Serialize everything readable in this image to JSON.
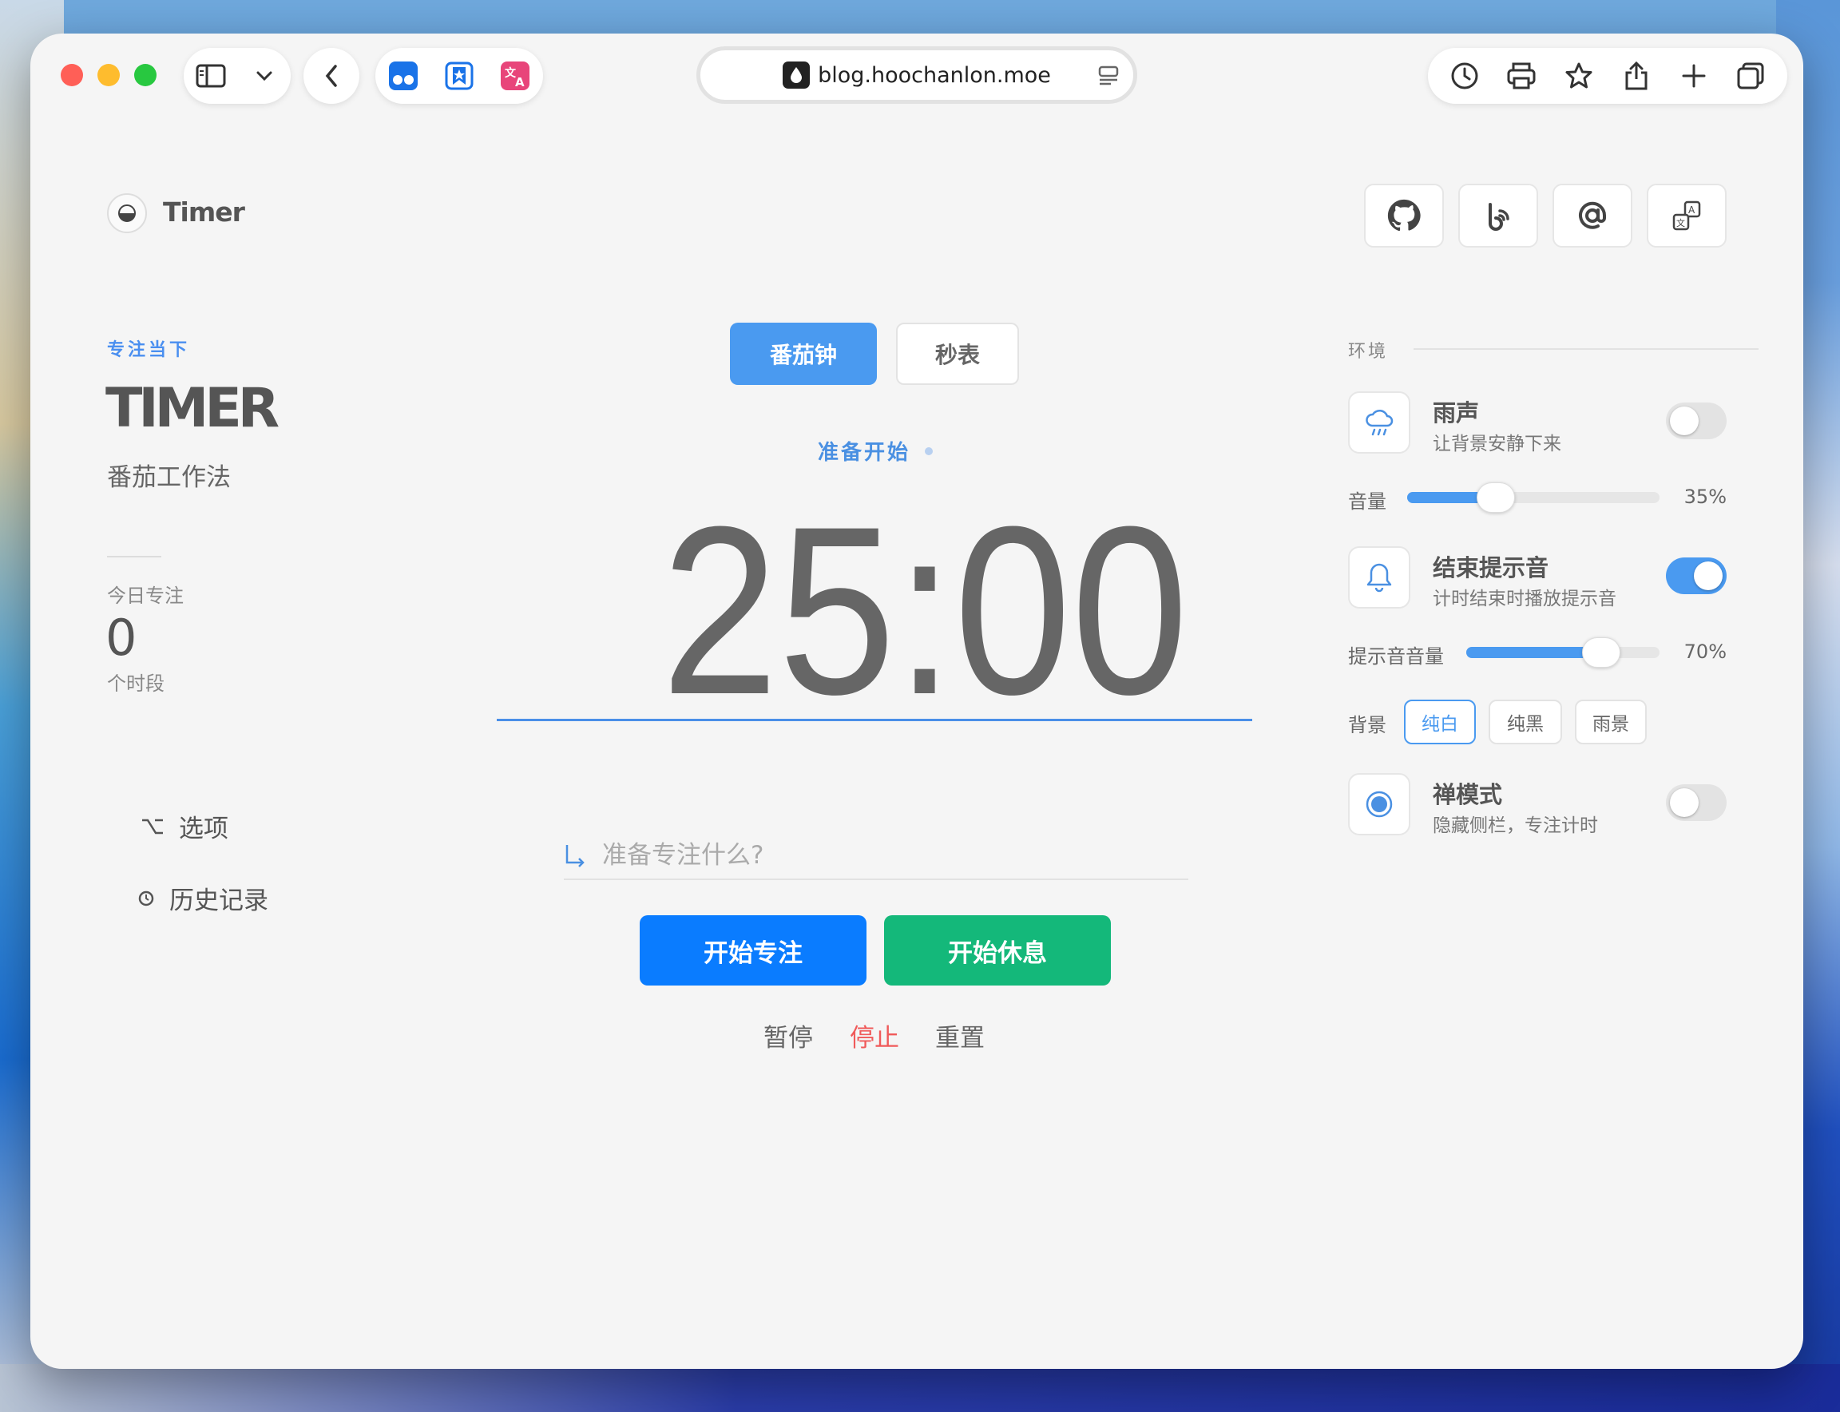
{
  "browser": {
    "url": "blog.hoochanlon.moe",
    "traffic_colors": {
      "close": "#ff5f57",
      "minimize": "#febc2e",
      "zoom": "#28c840"
    }
  },
  "header": {
    "logo_text": "Timer",
    "social_icons": [
      "github-icon",
      "bilibili-icon",
      "email-at-icon",
      "translate-icon"
    ]
  },
  "sidebar": {
    "eyebrow": "专注当下",
    "title": "TIMER",
    "subtitle": "番茄工作法",
    "stats": {
      "label": "今日专注",
      "value": "0",
      "unit": "个时段"
    },
    "nav": [
      {
        "icon": "option-key-icon",
        "label": "选项"
      },
      {
        "icon": "clock-icon",
        "label": "历史记录"
      }
    ]
  },
  "main": {
    "mode_tabs": [
      {
        "label": "番茄钟",
        "active": true
      },
      {
        "label": "秒表",
        "active": false
      }
    ],
    "status": "准备开始",
    "time": {
      "minutes": "25",
      "separator": ":",
      "seconds": "00"
    },
    "progress": 1.0,
    "task_placeholder": "准备专注什么?",
    "start_focus": "开始专注",
    "start_break": "开始休息",
    "pause": "暂停",
    "stop": "停止",
    "reset": "重置",
    "colors": {
      "accent": "#4a9af0",
      "focus_btn": "#0a7cff",
      "break_btn": "#14b87a",
      "stop": "#f05a5a"
    }
  },
  "panel": {
    "section": "环境",
    "rain": {
      "title": "雨声",
      "desc": "让背景安静下来",
      "enabled": false
    },
    "volume": {
      "label": "音量",
      "value": 35,
      "display": "35%"
    },
    "alert": {
      "title": "结束提示音",
      "desc": "计时结束时播放提示音",
      "enabled": true
    },
    "alert_volume": {
      "label": "提示音音量",
      "value": 70,
      "display": "70%"
    },
    "background": {
      "label": "背景",
      "options": [
        {
          "label": "纯白",
          "active": true
        },
        {
          "label": "纯黑",
          "active": false
        },
        {
          "label": "雨景",
          "active": false
        }
      ]
    },
    "zen": {
      "title": "禅模式",
      "desc": "隐藏侧栏，专注计时",
      "enabled": false
    }
  }
}
